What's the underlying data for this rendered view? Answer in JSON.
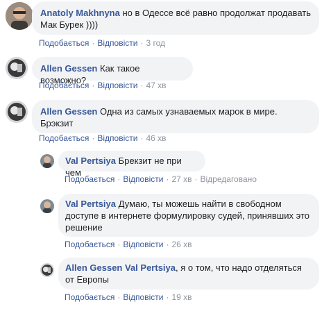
{
  "action_labels": {
    "like": "Подобається",
    "reply": "Відповісти",
    "separator": "·"
  },
  "comments": [
    {
      "author": "Anatoly Makhnyna",
      "text": "но в Одессе всё равно продолжат продавать Мак Бурек ))))",
      "time": "3 год"
    },
    {
      "author": "Allen Gessen",
      "text": "Как такое возможно?",
      "time": "47 хв"
    },
    {
      "author": "Allen Gessen",
      "text": "Одна из самых узнаваемых марок в мире. Брэкзит",
      "time": "46 хв"
    },
    {
      "author": "Val Pertsiya",
      "text": "Брекзит не при чем",
      "time": "27 хв",
      "edited": "Відредаговано"
    },
    {
      "author": "Val Pertsiya",
      "text": "Думаю, ты можешь найти в свободном доступе в интернете формулировку судей, принявших это решение",
      "time": "26 хв"
    },
    {
      "author": "Allen Gessen",
      "mention": "Val Pertsiya",
      "text": ", я о том, что надо отделяться от Европы",
      "time": "19 хв"
    }
  ]
}
